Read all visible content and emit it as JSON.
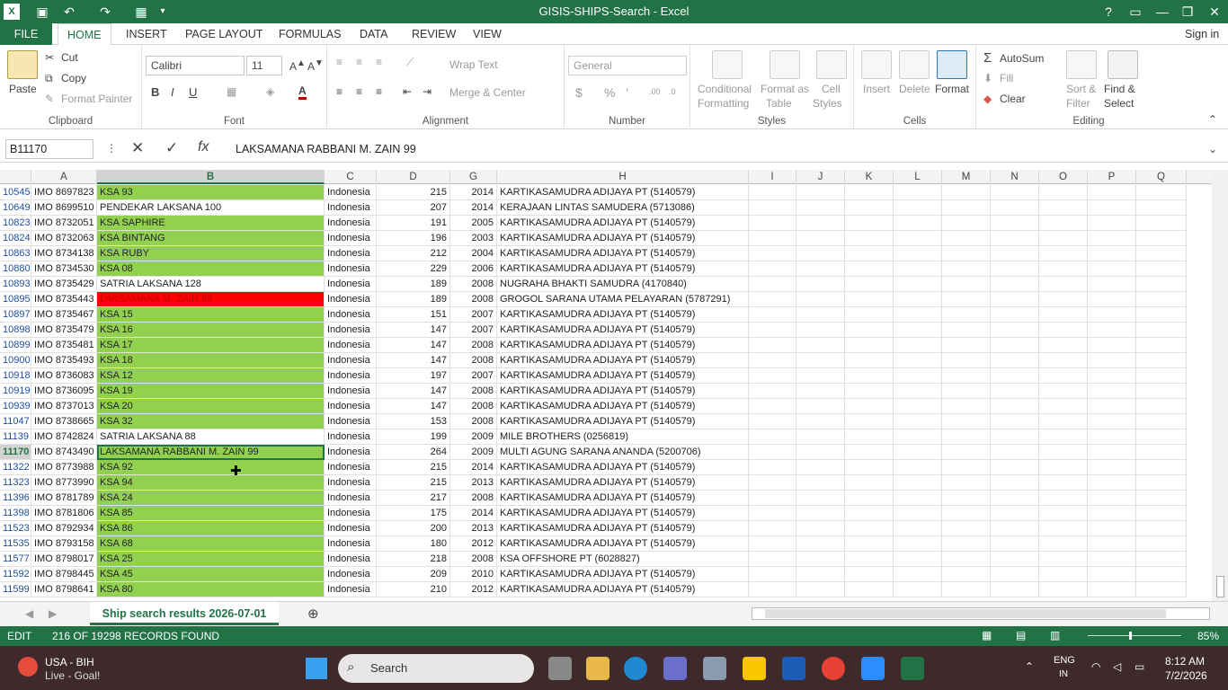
{
  "window": {
    "title": "GISIS-SHIPS-Search - Excel",
    "help": "?",
    "minimize": "—",
    "restore": "❐",
    "close": "✕"
  },
  "menu": {
    "file": "FILE",
    "tabs": [
      "HOME",
      "INSERT",
      "PAGE LAYOUT",
      "FORMULAS",
      "DATA",
      "REVIEW",
      "VIEW"
    ],
    "signin": "Sign in"
  },
  "ribbon": {
    "clipboard": {
      "paste": "Paste",
      "cut": "Cut",
      "copy": "Copy",
      "format_painter": "Format Painter",
      "label": "Clipboard"
    },
    "font": {
      "name": "Calibri",
      "size": "11",
      "bold": "B",
      "italic": "I",
      "underline": "U",
      "label": "Font"
    },
    "alignment": {
      "wrap": "Wrap Text",
      "merge": "Merge & Center",
      "label": "Alignment"
    },
    "number": {
      "format": "General",
      "currency": "$",
      "percent": "%",
      "comma": "’",
      "label": "Number"
    },
    "styles": {
      "cond": "Conditional",
      "cond2": "Formatting",
      "fat": "Format as",
      "fat2": "Table",
      "cs": "Cell",
      "cs2": "Styles",
      "label": "Styles"
    },
    "cells": {
      "insert": "Insert",
      "delete": "Delete",
      "format": "Format",
      "label": "Cells"
    },
    "editing": {
      "autosum": "AutoSum",
      "fill": "Fill",
      "clear": "Clear",
      "sort": "Sort &",
      "sort2": "Filter",
      "find": "Find &",
      "find2": "Select",
      "label": "Editing"
    }
  },
  "formula_bar": {
    "name_box": "B11170",
    "content": "LAKSAMANA RABBANI M. ZAIN 99"
  },
  "columns": [
    "A",
    "B",
    "C",
    "D",
    "G",
    "H",
    "I",
    "J",
    "K",
    "L",
    "M",
    "N",
    "O",
    "P",
    "Q"
  ],
  "rows": [
    {
      "n": "10545",
      "a": "IMO 8697823",
      "b": "KSA 93",
      "c": "Indonesia",
      "d": "215",
      "g": "2014",
      "h": "KARTIKASAMUDRA ADIJAYA PT (5140579)",
      "fill": "green"
    },
    {
      "n": "10649",
      "a": "IMO 8699510",
      "b": "PENDEKAR LAKSANA 100",
      "c": "Indonesia",
      "d": "207",
      "g": "2014",
      "h": "KERAJAAN LINTAS SAMUDERA (5713086)",
      "fill": "none"
    },
    {
      "n": "10823",
      "a": "IMO 8732051",
      "b": "KSA SAPHIRE",
      "c": "Indonesia",
      "d": "191",
      "g": "2005",
      "h": "KARTIKASAMUDRA ADIJAYA PT (5140579)",
      "fill": "green"
    },
    {
      "n": "10824",
      "a": "IMO 8732063",
      "b": "KSA BINTANG",
      "c": "Indonesia",
      "d": "196",
      "g": "2003",
      "h": "KARTIKASAMUDRA ADIJAYA PT (5140579)",
      "fill": "green"
    },
    {
      "n": "10863",
      "a": "IMO 8734138",
      "b": "KSA RUBY",
      "c": "Indonesia",
      "d": "212",
      "g": "2004",
      "h": "KARTIKASAMUDRA ADIJAYA PT (5140579)",
      "fill": "green"
    },
    {
      "n": "10880",
      "a": "IMO 8734530",
      "b": "KSA 08",
      "c": "Indonesia",
      "d": "229",
      "g": "2006",
      "h": "KARTIKASAMUDRA ADIJAYA PT (5140579)",
      "fill": "green"
    },
    {
      "n": "10893",
      "a": "IMO 8735429",
      "b": "SATRIA LAKSANA 128",
      "c": "Indonesia",
      "d": "189",
      "g": "2008",
      "h": "NUGRAHA BHAKTI SAMUDRA (4170840)",
      "fill": "none"
    },
    {
      "n": "10895",
      "a": "IMO 8735443",
      "b": "LAKSAMANA M. ZAIN 88",
      "c": "Indonesia",
      "d": "189",
      "g": "2008",
      "h": "GROGOL SARANA UTAMA PELAYARAN (5787291)",
      "fill": "red"
    },
    {
      "n": "10897",
      "a": "IMO 8735467",
      "b": "KSA 15",
      "c": "Indonesia",
      "d": "151",
      "g": "2007",
      "h": "KARTIKASAMUDRA ADIJAYA PT (5140579)",
      "fill": "green"
    },
    {
      "n": "10898",
      "a": "IMO 8735479",
      "b": "KSA 16",
      "c": "Indonesia",
      "d": "147",
      "g": "2007",
      "h": "KARTIKASAMUDRA ADIJAYA PT (5140579)",
      "fill": "green"
    },
    {
      "n": "10899",
      "a": "IMO 8735481",
      "b": "KSA 17",
      "c": "Indonesia",
      "d": "147",
      "g": "2008",
      "h": "KARTIKASAMUDRA ADIJAYA PT (5140579)",
      "fill": "green"
    },
    {
      "n": "10900",
      "a": "IMO 8735493",
      "b": "KSA 18",
      "c": "Indonesia",
      "d": "147",
      "g": "2008",
      "h": "KARTIKASAMUDRA ADIJAYA PT (5140579)",
      "fill": "green"
    },
    {
      "n": "10918",
      "a": "IMO 8736083",
      "b": "KSA 12",
      "c": "Indonesia",
      "d": "197",
      "g": "2007",
      "h": "KARTIKASAMUDRA ADIJAYA PT (5140579)",
      "fill": "green"
    },
    {
      "n": "10919",
      "a": "IMO 8736095",
      "b": "KSA 19",
      "c": "Indonesia",
      "d": "147",
      "g": "2008",
      "h": "KARTIKASAMUDRA ADIJAYA PT (5140579)",
      "fill": "green"
    },
    {
      "n": "10939",
      "a": "IMO 8737013",
      "b": "KSA 20",
      "c": "Indonesia",
      "d": "147",
      "g": "2008",
      "h": "KARTIKASAMUDRA ADIJAYA PT (5140579)",
      "fill": "green"
    },
    {
      "n": "11047",
      "a": "IMO 8738665",
      "b": "KSA 32",
      "c": "Indonesia",
      "d": "153",
      "g": "2008",
      "h": "KARTIKASAMUDRA ADIJAYA PT (5140579)",
      "fill": "green"
    },
    {
      "n": "11139",
      "a": "IMO 8742824",
      "b": "SATRIA LAKSANA 88",
      "c": "Indonesia",
      "d": "199",
      "g": "2009",
      "h": "MILE BROTHERS (0256819)",
      "fill": "none"
    },
    {
      "n": "11170",
      "a": "IMO 8743490",
      "b": "LAKSAMANA RABBANI M. ZAIN 99",
      "c": "Indonesia",
      "d": "264",
      "g": "2009",
      "h": "MULTI AGUNG SARANA ANANDA (5200706)",
      "fill": "green",
      "selected": true
    },
    {
      "n": "11322",
      "a": "IMO 8773988",
      "b": "KSA 92",
      "c": "Indonesia",
      "d": "215",
      "g": "2014",
      "h": "KARTIKASAMUDRA ADIJAYA PT (5140579)",
      "fill": "green"
    },
    {
      "n": "11323",
      "a": "IMO 8773990",
      "b": "KSA 94",
      "c": "Indonesia",
      "d": "215",
      "g": "2013",
      "h": "KARTIKASAMUDRA ADIJAYA PT (5140579)",
      "fill": "green"
    },
    {
      "n": "11396",
      "a": "IMO 8781789",
      "b": "KSA 24",
      "c": "Indonesia",
      "d": "217",
      "g": "2008",
      "h": "KARTIKASAMUDRA ADIJAYA PT (5140579)",
      "fill": "green"
    },
    {
      "n": "11398",
      "a": "IMO 8781806",
      "b": "KSA 85",
      "c": "Indonesia",
      "d": "175",
      "g": "2014",
      "h": "KARTIKASAMUDRA ADIJAYA PT (5140579)",
      "fill": "green"
    },
    {
      "n": "11523",
      "a": "IMO 8792934",
      "b": "KSA 86",
      "c": "Indonesia",
      "d": "200",
      "g": "2013",
      "h": "KARTIKASAMUDRA ADIJAYA PT (5140579)",
      "fill": "green"
    },
    {
      "n": "11535",
      "a": "IMO 8793158",
      "b": "KSA 68",
      "c": "Indonesia",
      "d": "180",
      "g": "2012",
      "h": "KARTIKASAMUDRA ADIJAYA PT (5140579)",
      "fill": "green"
    },
    {
      "n": "11577",
      "a": "IMO 8798017",
      "b": "KSA 25",
      "c": "Indonesia",
      "d": "218",
      "g": "2008",
      "h": "KSA OFFSHORE PT (6028827)",
      "fill": "green"
    },
    {
      "n": "11592",
      "a": "IMO 8798445",
      "b": "KSA 45",
      "c": "Indonesia",
      "d": "209",
      "g": "2010",
      "h": "KARTIKASAMUDRA ADIJAYA PT (5140579)",
      "fill": "green"
    },
    {
      "n": "11599",
      "a": "IMO 8798641",
      "b": "KSA 80",
      "c": "Indonesia",
      "d": "210",
      "g": "2012",
      "h": "KARTIKASAMUDRA ADIJAYA PT (5140579)",
      "fill": "green"
    }
  ],
  "sheet_tab": "Ship search results 2026-07-01",
  "status": {
    "mode": "EDIT",
    "records": "216 OF 19298 RECORDS FOUND",
    "zoom": "85%"
  },
  "taskbar": {
    "weather_title": "USA - BIH",
    "weather_sub": "Live - Goal!",
    "search": "Search",
    "lang": "ENG",
    "lang2": "IN",
    "time": "8:12 AM",
    "date": "7/2/2026"
  },
  "colors": {
    "excel_green": "#217346",
    "row_green": "#92d050",
    "row_red": "#ff0000"
  }
}
